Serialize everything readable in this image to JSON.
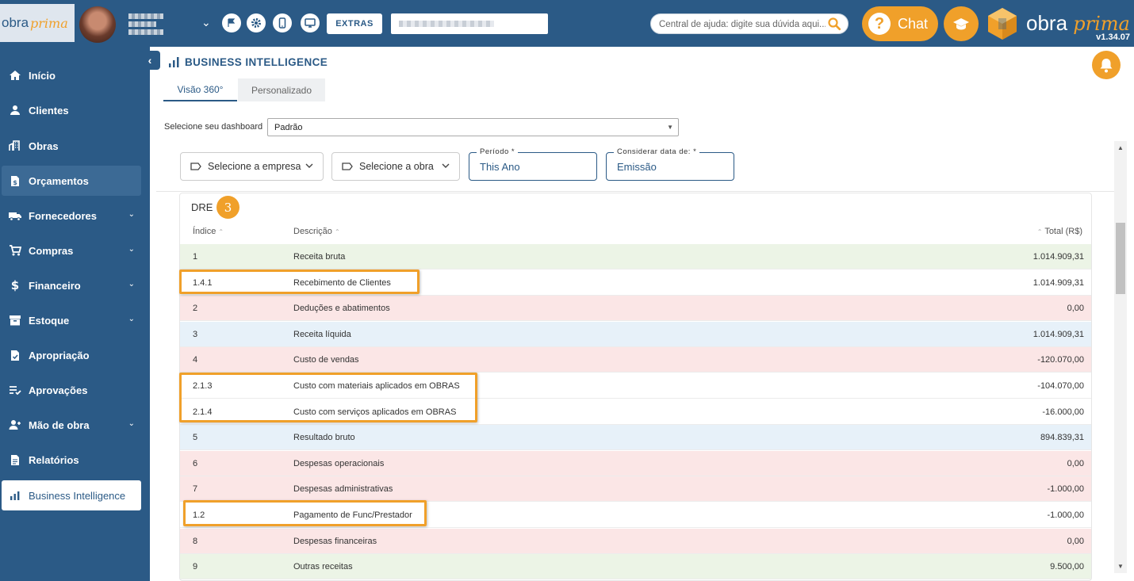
{
  "header": {
    "logo_text": "obra",
    "logo_script": "prima",
    "extras_label": "EXTRAS",
    "search_placeholder": "Central de ajuda: digite sua dúvida aqui...",
    "chat_label": "Chat",
    "chat_q": "?",
    "brand_text": "obra",
    "brand_script": "prima",
    "version": "v1.34.07"
  },
  "sidebar": {
    "items": [
      {
        "label": "Início",
        "icon": "home-icon"
      },
      {
        "label": "Clientes",
        "icon": "user-icon"
      },
      {
        "label": "Obras",
        "icon": "building-icon"
      },
      {
        "label": "Orçamentos",
        "icon": "invoice-icon"
      },
      {
        "label": "Fornecedores",
        "icon": "truck-icon"
      },
      {
        "label": "Compras",
        "icon": "cart-icon"
      },
      {
        "label": "Financeiro",
        "icon": "dollar-icon"
      },
      {
        "label": "Estoque",
        "icon": "box-icon"
      },
      {
        "label": "Apropriação",
        "icon": "check-document-icon"
      },
      {
        "label": "Aprovações",
        "icon": "approval-list-icon"
      },
      {
        "label": "Mão de obra",
        "icon": "worker-icon"
      },
      {
        "label": "Relatórios",
        "icon": "report-icon"
      },
      {
        "label": "Business Intelligence",
        "icon": "bar-chart-icon"
      }
    ]
  },
  "main": {
    "title": "BUSINESS INTELLIGENCE",
    "tabs": [
      {
        "label": "Visão 360°"
      },
      {
        "label": "Personalizado"
      }
    ],
    "dashboard_label": "Selecione seu dashboard",
    "dashboard_value": "Padrão",
    "filters": {
      "empresa": "Selecione a empresa",
      "obra": "Selecione a obra",
      "periodo_label": "Período *",
      "periodo_value": "This Ano",
      "data_label": "Considerar data de: *",
      "data_value": "Emissão"
    }
  },
  "dre": {
    "title": "DRE",
    "step": "3",
    "columns": {
      "indice": "Índice",
      "descricao": "Descrição",
      "total": "Total (R$)"
    },
    "rows": [
      {
        "indice": "1",
        "descricao": "Receita bruta",
        "total": "1.014.909,31",
        "tone": "green"
      },
      {
        "indice": "1.4.1",
        "descricao": "Recebimento de Clientes",
        "total": "1.014.909,31",
        "tone": "white"
      },
      {
        "indice": "2",
        "descricao": "Deduções e abatimentos",
        "total": "0,00",
        "tone": "red"
      },
      {
        "indice": "3",
        "descricao": "Receita líquida",
        "total": "1.014.909,31",
        "tone": "blue"
      },
      {
        "indice": "4",
        "descricao": "Custo de vendas",
        "total": "-120.070,00",
        "tone": "red"
      },
      {
        "indice": "2.1.3",
        "descricao": "Custo com materiais aplicados em OBRAS",
        "total": "-104.070,00",
        "tone": "white"
      },
      {
        "indice": "2.1.4",
        "descricao": "Custo com serviços aplicados em OBRAS",
        "total": "-16.000,00",
        "tone": "white"
      },
      {
        "indice": "5",
        "descricao": "Resultado bruto",
        "total": "894.839,31",
        "tone": "blue"
      },
      {
        "indice": "6",
        "descricao": "Despesas operacionais",
        "total": "0,00",
        "tone": "red"
      },
      {
        "indice": "7",
        "descricao": "Despesas administrativas",
        "total": "-1.000,00",
        "tone": "red"
      },
      {
        "indice": "1.2",
        "descricao": "Pagamento de Func/Prestador",
        "total": "-1.000,00",
        "tone": "white"
      },
      {
        "indice": "8",
        "descricao": "Despesas financeiras",
        "total": "0,00",
        "tone": "red"
      },
      {
        "indice": "9",
        "descricao": "Outras receitas",
        "total": "9.500,00",
        "tone": "green"
      }
    ]
  },
  "colors": {
    "primary": "#2b5a86",
    "accent": "#f0a02a"
  }
}
